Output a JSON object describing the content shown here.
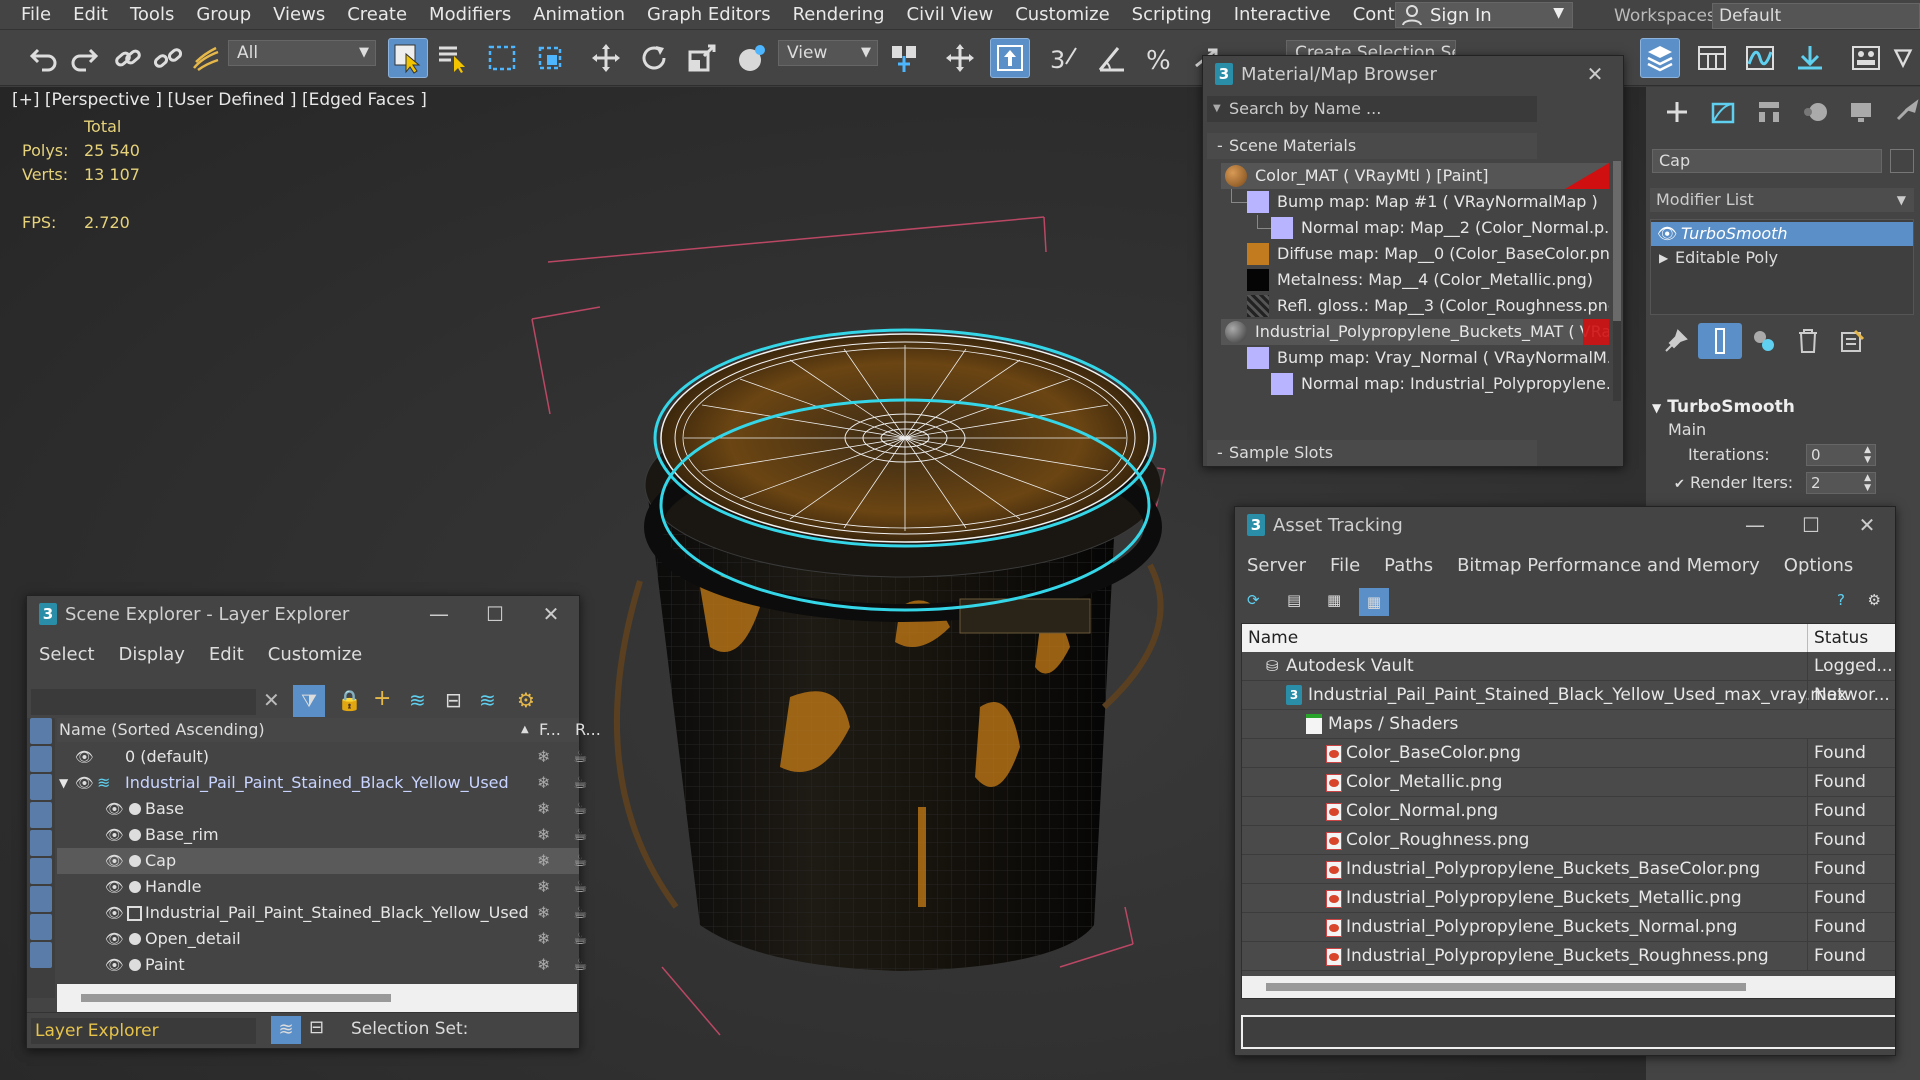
{
  "menu": [
    "File",
    "Edit",
    "Tools",
    "Group",
    "Views",
    "Create",
    "Modifiers",
    "Animation",
    "Graph Editors",
    "Rendering",
    "Civil View",
    "Customize",
    "Scripting",
    "Interactive",
    "Content"
  ],
  "menu_more": "»",
  "signin": "Sign In",
  "workspaces": {
    "label": "Workspaces:",
    "value": "Default"
  },
  "toolbar": {
    "filter": "All",
    "refcoord": "View",
    "selset": "Create Selection Set"
  },
  "viewport": {
    "label": "[+] [Perspective ] [User Defined ] [Edged Faces ]",
    "stats_header": "Total",
    "polys_label": "Polys:",
    "polys": "25 540",
    "verts_label": "Verts:",
    "verts": "13 107",
    "fps_label": "FPS:",
    "fps": "2.720"
  },
  "material_browser": {
    "title": "Material/Map Browser",
    "search_placeholder": "Search by Name ...",
    "section": "Scene Materials",
    "sample_slots": "Sample Slots",
    "items": [
      {
        "label": "Color_MAT  ( VRayMtl )  [Paint]",
        "swatch": "#b07a3a"
      },
      {
        "label": "Bump map: Map #1  ( VRayNormalMap )",
        "swatch": "#b9b4ff"
      },
      {
        "label": "Normal map: Map__2 (Color_Normal.p...",
        "swatch": "#b9b4ff"
      },
      {
        "label": "Diffuse map: Map__0 (Color_BaseColor.png)",
        "swatch": "#c27b1e"
      },
      {
        "label": "Metalness: Map__4 (Color_Metallic.png)",
        "swatch": "#050505"
      },
      {
        "label": "Refl. gloss.: Map__3 (Color_Roughness.png)",
        "swatch": "#3a3a3a"
      },
      {
        "label": "Industrial_Polypropylene_Buckets_MAT  ( VRa...",
        "swatch": "#6e6e6e"
      },
      {
        "label": "Bump map: Vray_Normal  ( VRayNormalM...",
        "swatch": "#b9b4ff"
      },
      {
        "label": "Normal map: Industrial_Polypropylene...",
        "swatch": "#b9b4ff"
      }
    ]
  },
  "command_panel": {
    "object_name": "Cap",
    "modifier_list": "Modifier List",
    "stack": [
      "TurboSmooth",
      "Editable Poly"
    ],
    "rollout": "TurboSmooth",
    "main": "Main",
    "iterations_label": "Iterations:",
    "iterations": "0",
    "render_iters_label": "Render Iters:",
    "render_iters": "2"
  },
  "scene_explorer": {
    "title": "Scene Explorer - Layer Explorer",
    "menu": [
      "Select",
      "Display",
      "Edit",
      "Customize"
    ],
    "col_name": "Name (Sorted Ascending)",
    "col_f": "F...",
    "col_r": "R...",
    "rows": [
      "0 (default)",
      "Industrial_Pail_Paint_Stained_Black_Yellow_Used",
      "Base",
      "Base_rim",
      "Cap",
      "Handle",
      "Industrial_Pail_Paint_Stained_Black_Yellow_Used",
      "Open_detail",
      "Paint"
    ],
    "bottom_select": "Layer Explorer",
    "selection_set": "Selection Set:"
  },
  "asset_tracking": {
    "title": "Asset Tracking",
    "menu": [
      "Server",
      "File",
      "Paths",
      "Bitmap Performance and Memory",
      "Options"
    ],
    "col_name": "Name",
    "col_status": "Status",
    "rows": [
      {
        "name": "Autodesk Vault",
        "status": "Logged..."
      },
      {
        "name": "Industrial_Pail_Paint_Stained_Black_Yellow_Used_max_vray.max",
        "status": "Networ..."
      },
      {
        "name": "Maps / Shaders",
        "status": ""
      },
      {
        "name": "Color_BaseColor.png",
        "status": "Found"
      },
      {
        "name": "Color_Metallic.png",
        "status": "Found"
      },
      {
        "name": "Color_Normal.png",
        "status": "Found"
      },
      {
        "name": "Color_Roughness.png",
        "status": "Found"
      },
      {
        "name": "Industrial_Polypropylene_Buckets_BaseColor.png",
        "status": "Found"
      },
      {
        "name": "Industrial_Polypropylene_Buckets_Metallic.png",
        "status": "Found"
      },
      {
        "name": "Industrial_Polypropylene_Buckets_Normal.png",
        "status": "Found"
      },
      {
        "name": "Industrial_Polypropylene_Buckets_Roughness.png",
        "status": "Found"
      }
    ]
  }
}
